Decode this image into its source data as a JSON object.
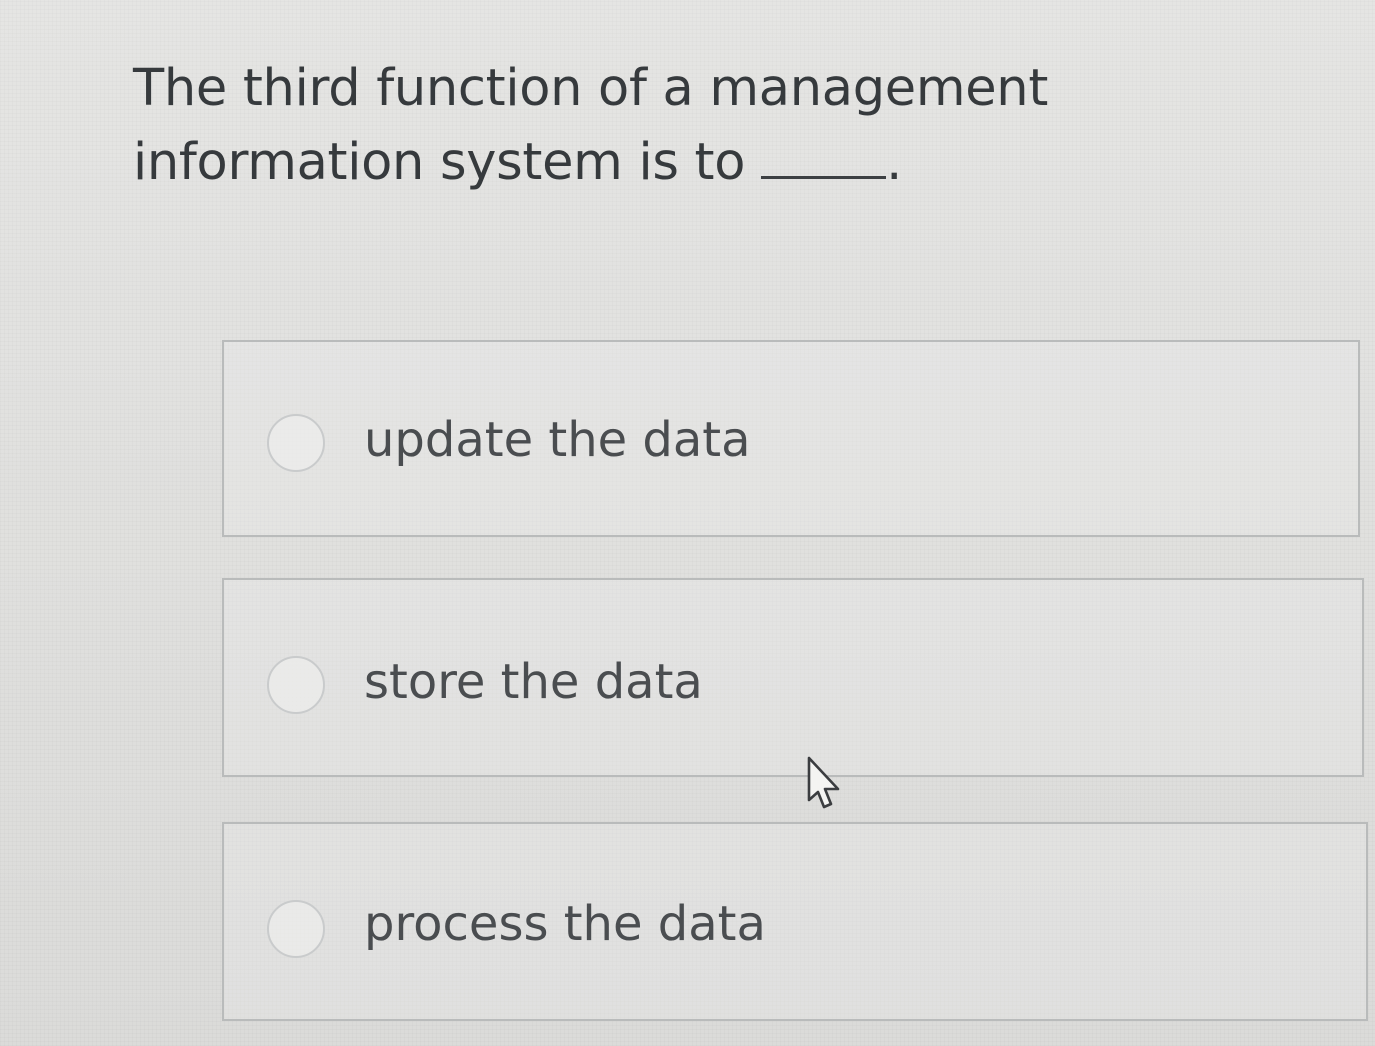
{
  "question": {
    "text": "The third function of a management information system is to",
    "blank_end": "."
  },
  "options": [
    {
      "label": "update the data",
      "selected": false
    },
    {
      "label": "store the data",
      "selected": false
    },
    {
      "label": "process the data",
      "selected": false
    }
  ],
  "icons": {
    "cursor": "hand-pointer-cursor-icon",
    "radio": "radio-button-icon"
  }
}
